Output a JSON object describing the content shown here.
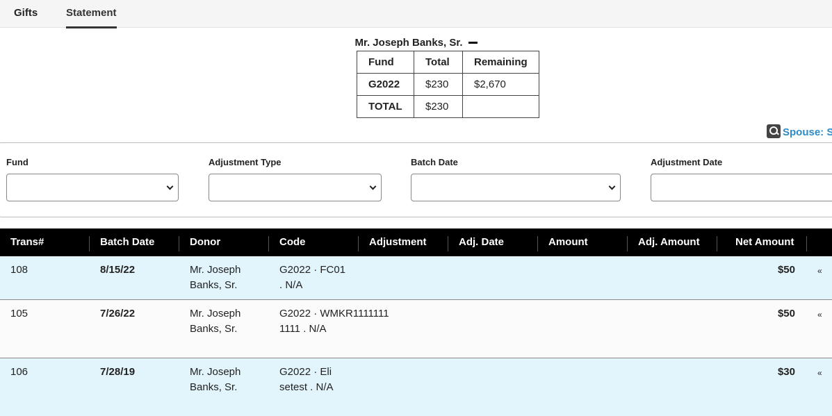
{
  "tabs": [
    {
      "label": "Gifts"
    },
    {
      "label": "Statement"
    }
  ],
  "summary": {
    "name": "Mr. Joseph Banks, Sr.",
    "headers": [
      "Fund",
      "Total",
      "Remaining"
    ],
    "rows": [
      {
        "fund": "G2022",
        "total": "$230",
        "remaining": "$2,670"
      },
      {
        "fund": "TOTAL",
        "total": "$230",
        "remaining": ""
      }
    ]
  },
  "spouse": {
    "label": "Spouse: Sc"
  },
  "filters": {
    "fund_label": "Fund",
    "adjustment_type_label": "Adjustment Type",
    "batch_date_label": "Batch Date",
    "adjustment_date_label": "Adjustment Date"
  },
  "table": {
    "columns": [
      "Trans#",
      "Batch Date",
      "Donor",
      "Code",
      "Adjustment",
      "Adj. Date",
      "Amount",
      "Adj. Amount",
      "Net Amount"
    ],
    "rows": [
      {
        "trans": "108",
        "batch_date": "8/15/22",
        "donor": "Mr. Joseph Banks, Sr.",
        "code": "G2022 · FC01 . N/A",
        "net": "$50",
        "expand": "«"
      },
      {
        "trans": "105",
        "batch_date": "7/26/22",
        "donor": "Mr. Joseph Banks, Sr.",
        "code": "G2022 · WMKR11111111111 . N/A",
        "net": "$50",
        "expand": "«"
      },
      {
        "trans": "106",
        "batch_date": "7/28/19",
        "donor": "Mr. Joseph Banks, Sr.",
        "code": "G2022 · Elisetest . N/A",
        "net": "$30",
        "expand": "«"
      }
    ]
  },
  "colors": {
    "accent_link": "#2f8ac5",
    "row_alt": "#e3f5fc",
    "header_bg": "#000000"
  }
}
